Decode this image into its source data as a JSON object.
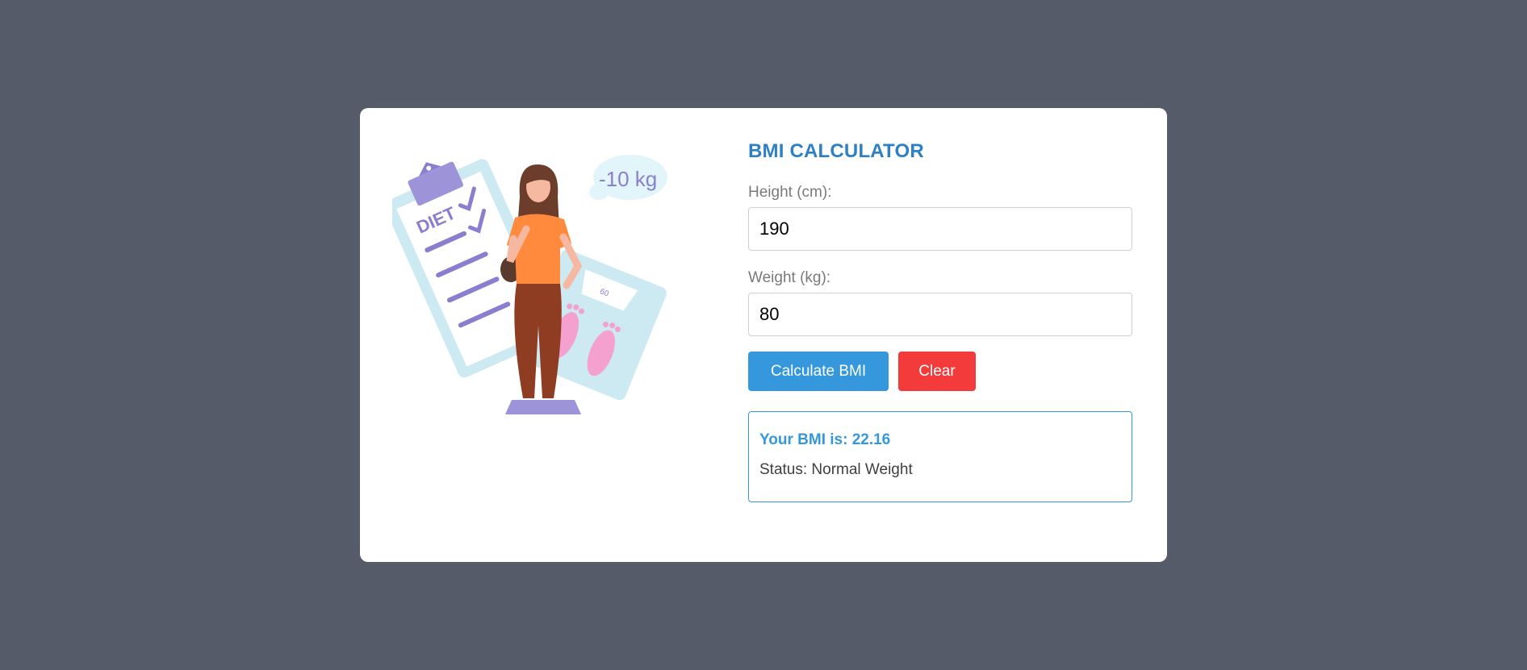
{
  "app": {
    "title": "BMI CALCULATOR"
  },
  "illustration": {
    "clipboard_text": "DIET",
    "speech_bubble_text": "-10 kg",
    "scale_dial_text": "60"
  },
  "form": {
    "height_label": "Height (cm):",
    "height_value": "190",
    "weight_label": "Weight (kg):",
    "weight_value": "80",
    "calculate_label": "Calculate BMI",
    "clear_label": "Clear"
  },
  "result": {
    "bmi_text": "Your BMI is: 22.16",
    "status_text": "Status: Normal Weight"
  },
  "colors": {
    "page_background": "#555b69",
    "card_background": "#ffffff",
    "title_color": "#2d80c4",
    "primary": "#3598dc",
    "danger": "#f33b3b"
  }
}
